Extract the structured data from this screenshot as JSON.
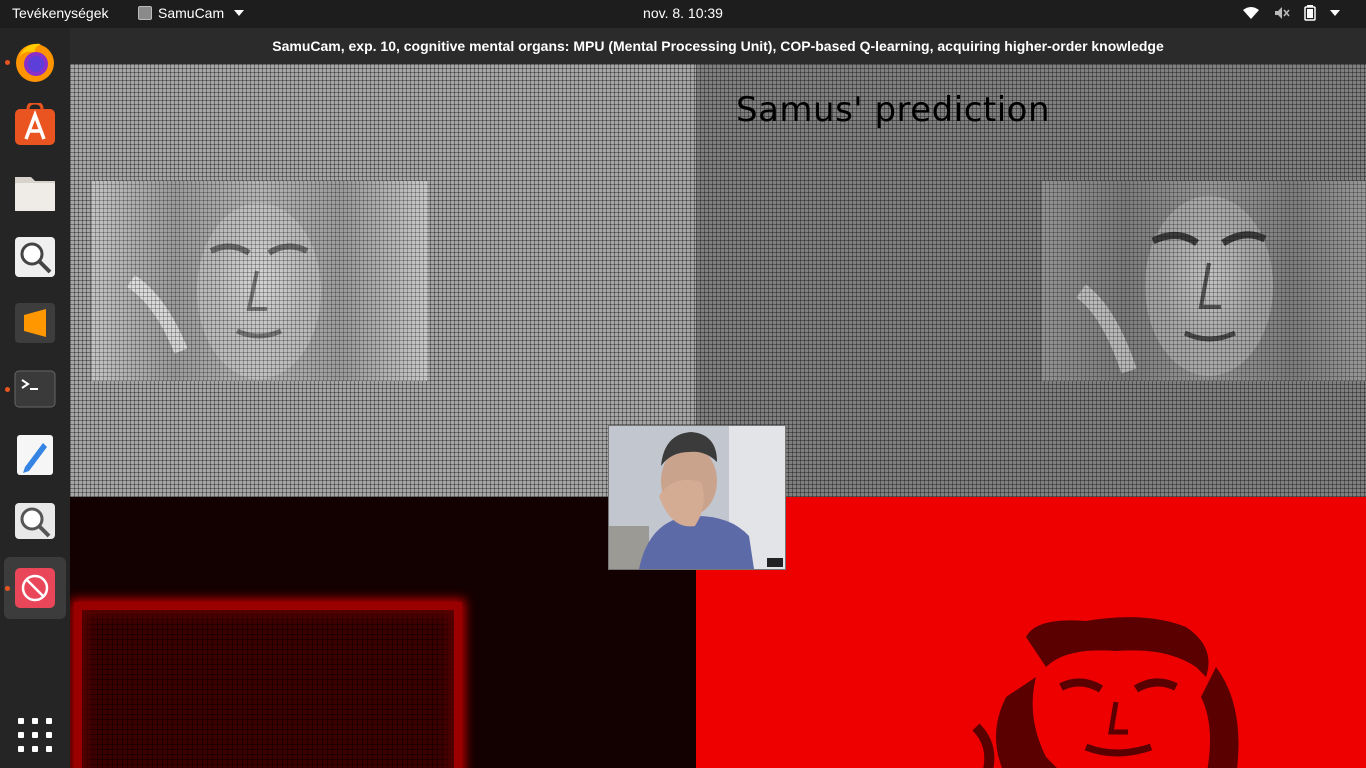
{
  "topbar": {
    "activities": "Tevékenységek",
    "app_name": "SamuCam",
    "clock": "nov. 8.  10:39"
  },
  "window": {
    "title": "SamuCam, exp. 10, cognitive mental organs: MPU (Mental Processing Unit), COP-based Q-learning, acquiring higher-order knowledge"
  },
  "panels": {
    "prediction_label": "Samus' prediction"
  },
  "dock": {
    "items": [
      {
        "icon": "firefox-icon",
        "running": true
      },
      {
        "icon": "software-center-icon",
        "running": false
      },
      {
        "icon": "files-icon",
        "running": false
      },
      {
        "icon": "magnifier-icon",
        "running": false
      },
      {
        "icon": "sublime-text-icon",
        "running": false
      },
      {
        "icon": "terminal-icon",
        "running": true
      },
      {
        "icon": "text-editor-icon",
        "running": false
      },
      {
        "icon": "image-viewer-icon",
        "running": false
      },
      {
        "icon": "samucam-icon",
        "running": true,
        "active": true
      }
    ]
  },
  "colors": {
    "accent": "#e95420",
    "topbar_bg": "#1d1d1d",
    "dock_bg": "#252525",
    "red_panel": "#ee0000",
    "dark_red_panel": "#130000"
  }
}
